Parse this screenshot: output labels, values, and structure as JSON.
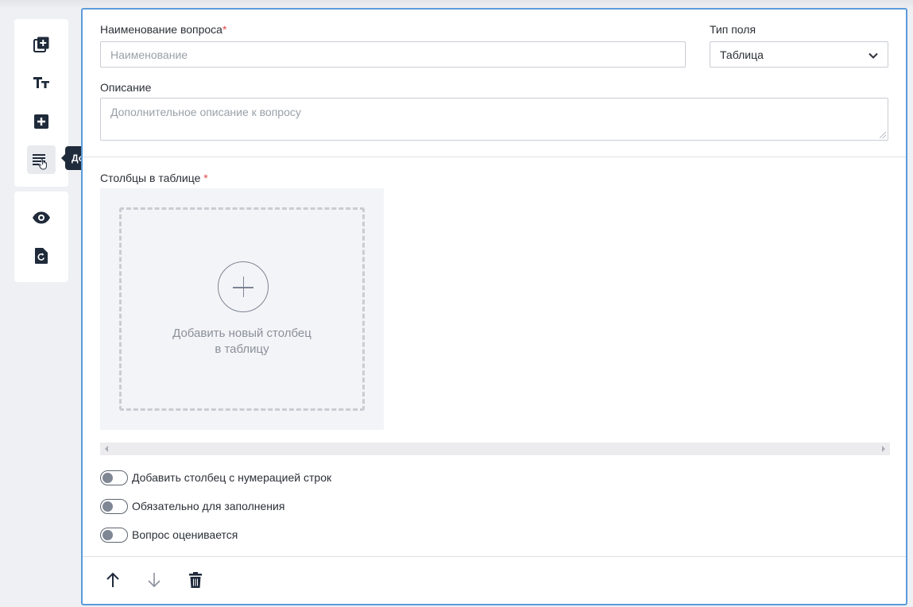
{
  "toolbar": {
    "groups": [
      {
        "items": [
          "add-question-icon",
          "text-format-icon",
          "add-block-icon",
          "add-table-icon"
        ]
      },
      {
        "items": [
          "eye-icon",
          "reset-icon"
        ]
      }
    ],
    "tooltip": "Добавить таблицу"
  },
  "question": {
    "name_label": "Наименование вопроса",
    "name_required_mark": "*",
    "name_placeholder": "Наименование",
    "type_label": "Тип поля",
    "type_value": "Таблица",
    "description_label": "Описание",
    "description_placeholder": "Дополнительное описание к вопросу"
  },
  "table": {
    "columns_label": "Столбцы в таблице",
    "columns_required_mark": "*",
    "add_column_line1": "Добавить новый столбец",
    "add_column_line2": "в таблицу"
  },
  "toggles": [
    {
      "label": "Добавить столбец с нумерацией строк",
      "on": false
    },
    {
      "label": "Обязательно для заполнения",
      "on": false
    },
    {
      "label": "Вопрос оценивается",
      "on": false
    }
  ],
  "footer": {
    "icons": [
      "arrow-up-icon",
      "arrow-down-icon",
      "trash-icon"
    ]
  },
  "colors": {
    "accent_border": "#5b9bd9",
    "required": "#e5484d",
    "icon_dark": "#1f2a3a",
    "background": "#eef0f3"
  }
}
